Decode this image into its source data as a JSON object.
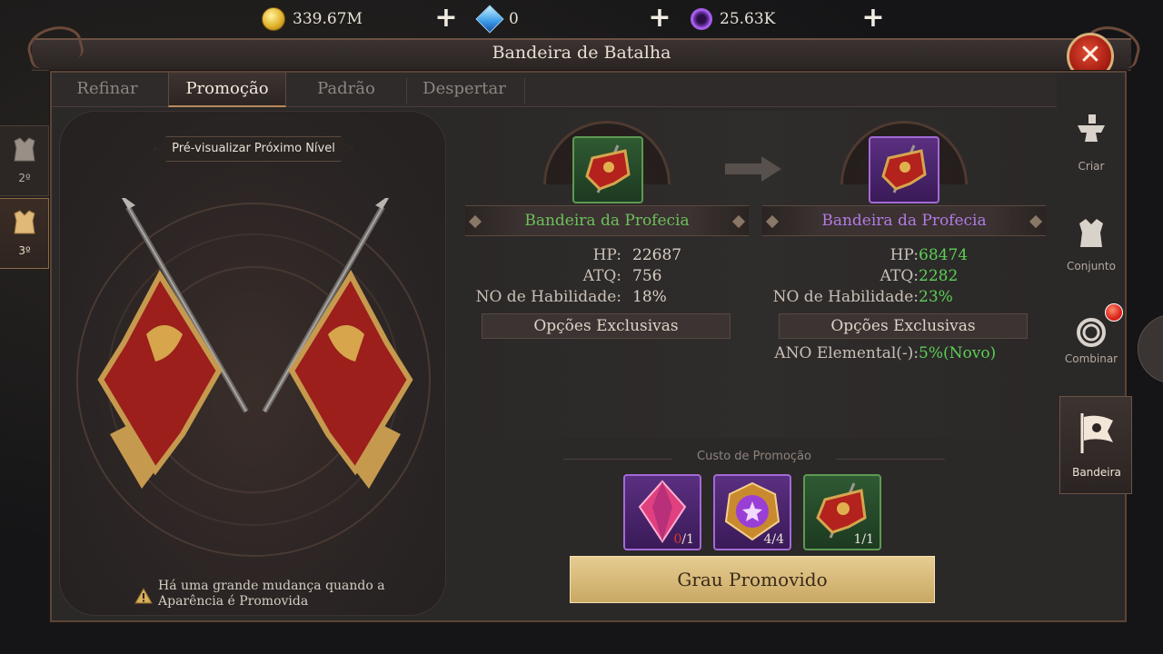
{
  "resources": [
    {
      "icon": "gold-coin-icon",
      "amount": "339.67M"
    },
    {
      "icon": "diamond-icon",
      "amount": "0"
    },
    {
      "icon": "purple-orb-icon",
      "amount": "25.63K"
    }
  ],
  "window": {
    "title": "Bandeira de Batalha",
    "close_label": "✕"
  },
  "tabs": [
    {
      "label": "Refinar",
      "active": false
    },
    {
      "label": "Promoção",
      "active": true
    },
    {
      "label": "Padrão",
      "active": false
    },
    {
      "label": "Despertar",
      "active": false
    }
  ],
  "side_tabs": [
    {
      "label": "2º",
      "active": false
    },
    {
      "label": "3º",
      "active": true
    }
  ],
  "preview": {
    "label": "Pré-visualizar Próximo Nível",
    "note": "Há uma grande mudança quando a Aparência é Promovida"
  },
  "current": {
    "name": "Bandeira da Profecia",
    "name_color": "#6cc05c",
    "stats": [
      {
        "key": "HP:",
        "value": "22687"
      },
      {
        "key": "ATQ:",
        "value": "756"
      },
      {
        "key": "NO de Habilidade:",
        "value": "18%"
      }
    ],
    "options_label": "Opções Exclusivas"
  },
  "next": {
    "name": "Bandeira da Profecia",
    "name_color": "#b47ae6",
    "stats": [
      {
        "key": "HP:",
        "value": "68474"
      },
      {
        "key": "ATQ:",
        "value": "2282"
      },
      {
        "key": "NO de Habilidade:",
        "value": "23%"
      }
    ],
    "options_label": "Opções Exclusivas",
    "extra_option": {
      "key": "ANO Elemental(-):",
      "value": "5%(Novo)"
    }
  },
  "cost": {
    "label": "Custo de Promoção",
    "items": [
      {
        "icon": "pink-crystal-icon",
        "have": "0",
        "need": "/1",
        "frame": "purple"
      },
      {
        "icon": "purple-emblem-icon",
        "have": "4",
        "need": "/4",
        "frame": "purple"
      },
      {
        "icon": "battle-flag-icon",
        "have": "1",
        "need": "/1",
        "frame": "green"
      }
    ]
  },
  "promote_button": "Grau Promovido",
  "right_nav": [
    {
      "label": "Criar",
      "icon": "anvil-icon",
      "active": false,
      "badge": false
    },
    {
      "label": "Conjunto",
      "icon": "armor-icon",
      "active": false,
      "badge": false
    },
    {
      "label": "Combinar",
      "icon": "ring-icon",
      "active": false,
      "badge": true
    },
    {
      "label": "Bandeira",
      "icon": "flag-icon",
      "active": true,
      "badge": false
    }
  ],
  "colors": {
    "stat_value_green": "#5ccf55",
    "shortage_red": "#e23a2a",
    "gold_button": "#d8bb78"
  }
}
